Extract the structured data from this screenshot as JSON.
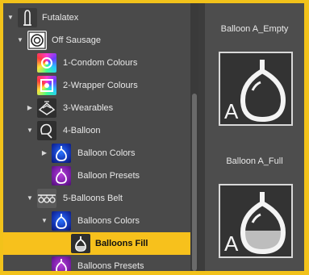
{
  "tree": {
    "items": [
      {
        "label": "Futalatex",
        "expanded": true,
        "icon": "figure-icon"
      },
      {
        "label": "Off Sausage",
        "expanded": true,
        "icon": "product-icon"
      },
      {
        "label": "1-Condom Colours",
        "icon": "rainbow-swatch-icon"
      },
      {
        "label": "2-Wrapper Colours",
        "icon": "rainbow-swatch-icon"
      },
      {
        "label": "3-Wearables",
        "expanded": false,
        "icon": "wearables-icon"
      },
      {
        "label": "4-Balloon",
        "expanded": true,
        "icon": "balloon-outline-icon"
      },
      {
        "label": "Balloon Colors",
        "expanded": false,
        "icon": "blue-balloon-icon"
      },
      {
        "label": "Balloon Presets",
        "icon": "purple-balloon-icon"
      },
      {
        "label": "5-Balloons Belt",
        "expanded": true,
        "icon": "balloons-belt-icon"
      },
      {
        "label": "Balloons Colors",
        "expanded": true,
        "icon": "blue-balloon-icon"
      },
      {
        "label": "Balloons Fill",
        "selected": true,
        "icon": "balloon-fill-icon"
      },
      {
        "label": "Balloons Presets",
        "icon": "purple-balloon-icon"
      }
    ]
  },
  "presets": [
    {
      "title": "Balloon A_Empty",
      "letter": "A",
      "fill": "empty"
    },
    {
      "title": "Balloon A_Full",
      "letter": "A",
      "fill": "full"
    }
  ],
  "colors": {
    "frame": "#f2c21a",
    "selection": "#f7c11c",
    "panel": "#4a4a4a"
  }
}
